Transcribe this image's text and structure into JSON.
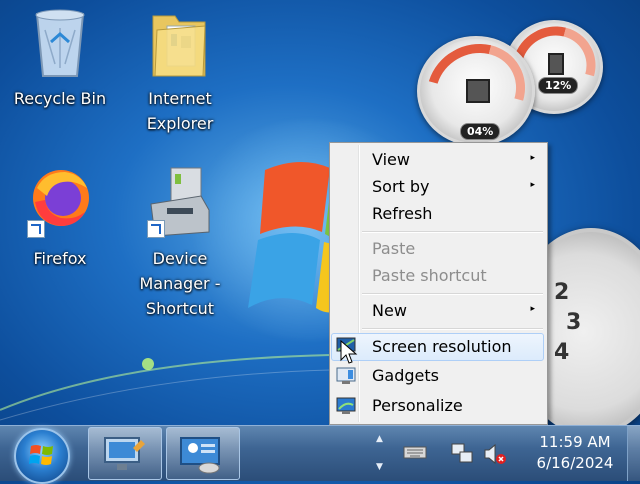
{
  "desktop": {
    "icons": [
      {
        "label_lines": [
          "Recycle Bin"
        ],
        "icon": "recycle-bin-icon"
      },
      {
        "label_lines": [
          "Internet",
          "Explorer"
        ],
        "icon": "folder-icon"
      },
      {
        "label_lines": [
          "Firefox"
        ],
        "icon": "firefox-icon"
      },
      {
        "label_lines": [
          "Device",
          "Manager -",
          "Shortcut"
        ],
        "icon": "device-manager-icon"
      }
    ],
    "gadgets": {
      "cpu_meter": {
        "cpu_percent": "04%",
        "memory_percent": "12%"
      }
    }
  },
  "context_menu": {
    "items": [
      {
        "label": "View",
        "submenu": true,
        "enabled": true
      },
      {
        "label": "Sort by",
        "submenu": true,
        "enabled": true
      },
      {
        "label": "Refresh",
        "submenu": false,
        "enabled": true
      },
      {
        "label": "Paste",
        "submenu": false,
        "enabled": false
      },
      {
        "label": "Paste shortcut",
        "submenu": false,
        "enabled": false
      },
      {
        "label": "New",
        "submenu": true,
        "enabled": true
      },
      {
        "label": "Screen resolution",
        "submenu": false,
        "enabled": true,
        "highlighted": true,
        "icon": "screen-resolution-icon"
      },
      {
        "label": "Gadgets",
        "submenu": false,
        "enabled": true,
        "icon": "gadgets-icon"
      },
      {
        "label": "Personalize",
        "submenu": false,
        "enabled": true,
        "icon": "personalize-icon"
      }
    ],
    "submenu_arrow": "▸"
  },
  "taskbar": {
    "time": "11:59 AM",
    "date": "6/16/2024",
    "tray_icons": [
      "keyboard-icon",
      "network-icon",
      "volume-muted-icon"
    ]
  }
}
